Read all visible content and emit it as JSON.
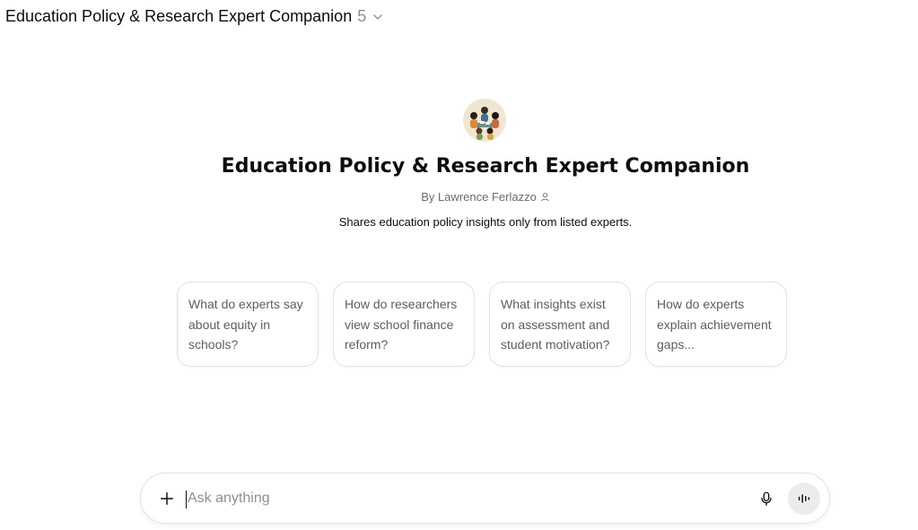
{
  "header": {
    "title": "Education Policy & Research Expert Companion",
    "version": "5",
    "chevron_icon": "chevron-down-icon"
  },
  "gpt": {
    "name": "Education Policy & Research Expert Companion",
    "byline": "By Lawrence Ferlazzo",
    "byline_icon": "person-icon",
    "description": "Shares education policy insights only from listed experts."
  },
  "starters": [
    {
      "label": "What do experts say about equity in schools?"
    },
    {
      "label": "How do researchers view school finance reform?"
    },
    {
      "label": "What insights exist on assessment and student motivation?"
    },
    {
      "label": "How do experts explain achievement gaps..."
    }
  ],
  "composer": {
    "placeholder": "Ask anything",
    "plus_icon": "plus-icon",
    "mic_icon": "microphone-icon",
    "voice_icon": "voice-mode-icon"
  }
}
